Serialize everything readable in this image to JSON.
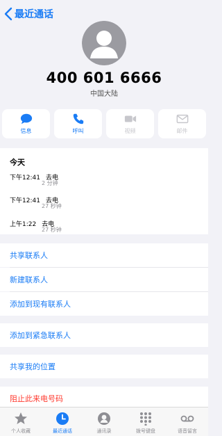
{
  "nav": {
    "back_label": "最近通话"
  },
  "contact": {
    "number": "400 601 6666",
    "region": "中国大陆"
  },
  "actions": [
    {
      "label": "信息",
      "enabled": true,
      "icon": "message-icon"
    },
    {
      "label": "呼叫",
      "enabled": true,
      "icon": "phone-icon"
    },
    {
      "label": "视频",
      "enabled": false,
      "icon": "video-icon"
    },
    {
      "label": "邮件",
      "enabled": false,
      "icon": "mail-icon"
    }
  ],
  "history": {
    "title": "今天",
    "entries": [
      {
        "time": "下午12:41",
        "type": "去电",
        "duration": "2 分钟"
      },
      {
        "time": "下午12:41",
        "type": "去电",
        "duration": "27 秒钟"
      },
      {
        "time": "上午1:22",
        "type": "去电",
        "duration": "27 秒钟"
      }
    ]
  },
  "links": {
    "share_contact": "共享联系人",
    "new_contact": "新建联系人",
    "add_existing": "添加到现有联系人",
    "add_emergency": "添加到紧急联系人",
    "share_location": "共享我的位置",
    "block_caller": "阻止此来电号码"
  },
  "tabs": [
    {
      "label": "个人收藏",
      "icon": "star-icon",
      "active": false
    },
    {
      "label": "最近通话",
      "icon": "clock-icon",
      "active": true
    },
    {
      "label": "通讯录",
      "icon": "person-icon",
      "active": false
    },
    {
      "label": "拨号键盘",
      "icon": "keypad-icon",
      "active": false
    },
    {
      "label": "语音留言",
      "icon": "voicemail-icon",
      "active": false
    }
  ],
  "colors": {
    "accent": "#1a7cf5",
    "danger": "#ff3b30",
    "disabled": "#c7c7cc",
    "background": "#f2f2f7"
  }
}
